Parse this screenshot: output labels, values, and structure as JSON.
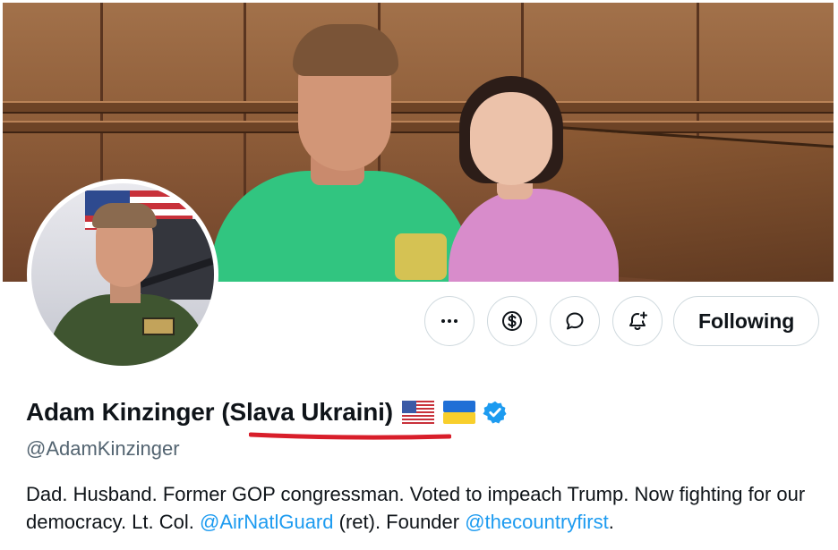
{
  "profile": {
    "display_name": "Adam Kinzinger",
    "name_suffix": "(Slava Ukraini)",
    "flags": [
      "us-flag-icon",
      "ukraine-flag-icon"
    ],
    "verified": true,
    "handle": "@AdamKinzinger",
    "bio": {
      "part1": "Dad. Husband. Former GOP congressman. Voted to impeach Trump. Now fighting for our democracy. Lt. Col. ",
      "mention1": "@AirNatlGuard",
      "part2": " (ret). Founder ",
      "mention2": "@thecountryfirst",
      "part3": "."
    }
  },
  "actions": {
    "more_icon": "more-icon",
    "subscribe_icon": "subscribe-dollar-icon",
    "message_icon": "message-icon",
    "notify_icon": "notification-bell-icon",
    "follow_label": "Following"
  },
  "colors": {
    "accent": "#1d9bf0",
    "text_primary": "#0f1419",
    "text_secondary": "#536471",
    "annotation_underline": "#d81e2a"
  }
}
